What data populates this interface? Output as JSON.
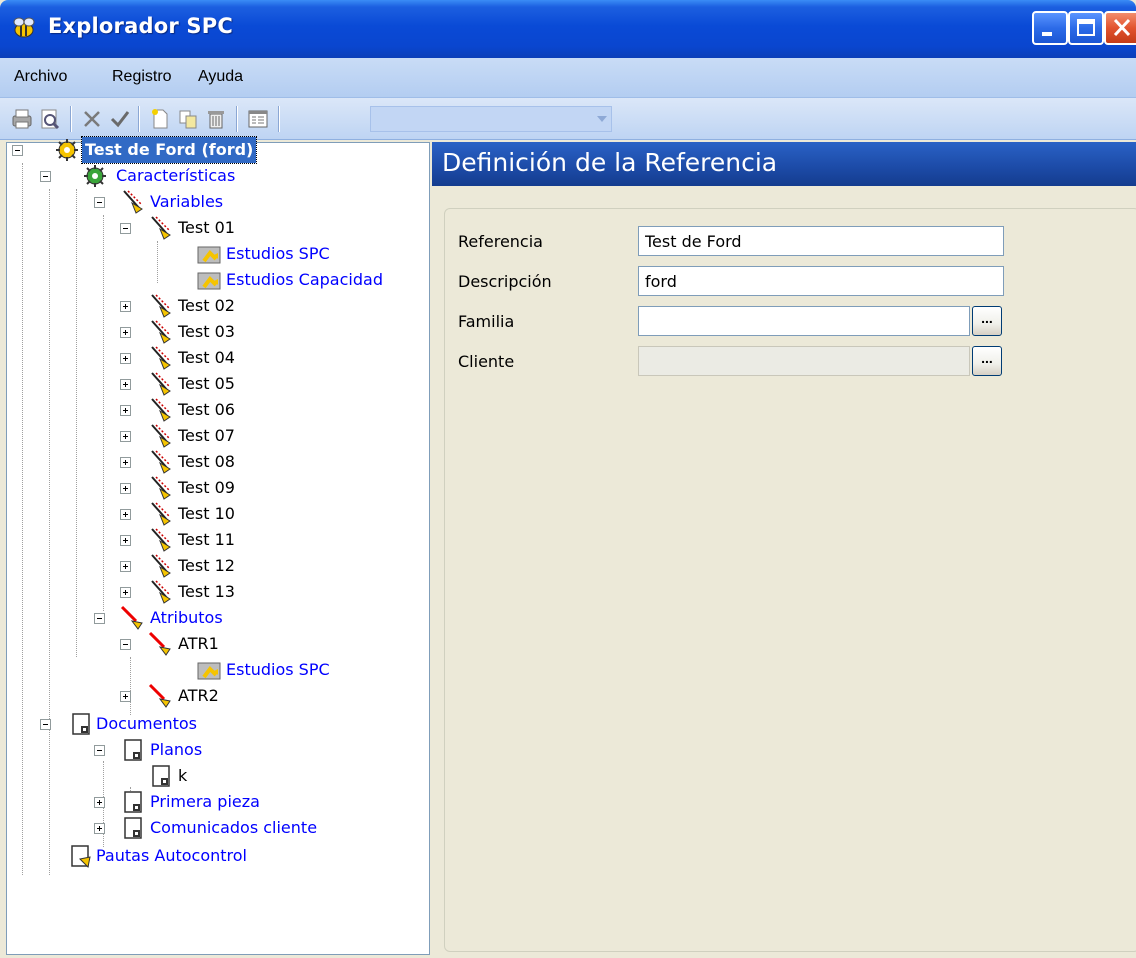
{
  "window": {
    "title": "Explorador SPC",
    "app_icon": "bee-icon",
    "buttons": [
      "minimize-icon",
      "maximize-icon",
      "close-icon"
    ]
  },
  "menu": {
    "items": [
      {
        "label": "Archivo"
      },
      {
        "label": "Registro"
      },
      {
        "label": "Ayuda"
      }
    ]
  },
  "toolbar": {
    "icons": [
      "printer-icon",
      "print-preview-icon",
      "cancel-icon",
      "check-icon",
      "new-document-icon",
      "copy-icon",
      "delete-icon",
      "properties-icon"
    ]
  },
  "tree": {
    "root": "Test de Ford (ford)",
    "caracteristicas": "Características",
    "variables": "Variables",
    "test01": "Test 01",
    "estudios_spc_1": "Estudios SPC",
    "estudios_capacidad": "Estudios Capacidad",
    "tests": [
      "Test 02",
      "Test 03",
      "Test 04",
      "Test 05",
      "Test 06",
      "Test 07",
      "Test 08",
      "Test 09",
      "Test 10",
      "Test 11",
      "Test 12",
      "Test 13"
    ],
    "atributos": "Atributos",
    "atr1": "ATR1",
    "estudios_spc_2": "Estudios SPC",
    "atr2": "ATR2",
    "documentos": "Documentos",
    "planos": "Planos",
    "k": "k",
    "primera_pieza": "Primera pieza",
    "comunicados": "Comunicados cliente",
    "pautas": "Pautas Autocontrol"
  },
  "detail": {
    "header": "Definición de la Referencia",
    "fields": {
      "referencia_label": "Referencia",
      "referencia_value": "Test de Ford",
      "descripcion_label": "Descripción",
      "descripcion_value": "ford",
      "familia_label": "Familia",
      "familia_value": "",
      "cliente_label": "Cliente",
      "cliente_value": ""
    },
    "browse_label": "..."
  }
}
